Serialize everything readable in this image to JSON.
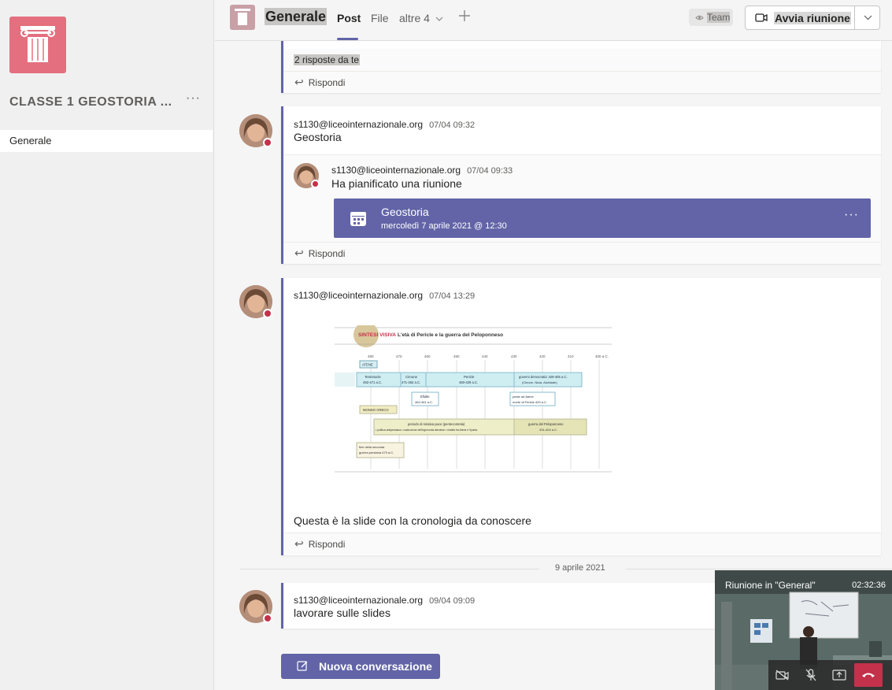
{
  "sidebar": {
    "team_name": "CLASSE 1 GEOSTORIA ...",
    "more_label": "···",
    "channels": [
      {
        "label": "Generale"
      }
    ]
  },
  "header": {
    "channel_title": "Generale",
    "tabs": {
      "post": "Post",
      "file": "File",
      "more": "altre 4"
    },
    "team_label": "Team",
    "meet_label": "Avvia riunione"
  },
  "thread0": {
    "replies_label": "2 risposte da te",
    "reply_label": "Rispondi"
  },
  "thread1": {
    "author": "s1130@liceointernazionale.org",
    "time": "07/04 09:32",
    "text": "Geostoria",
    "reply": {
      "author": "s1130@liceointernazionale.org",
      "time": "07/04 09:33",
      "text": "Ha pianificato una riunione",
      "meeting": {
        "title": "Geostoria",
        "when": "mercoledì 7 aprile 2021 @ 12:30",
        "more": "···"
      }
    },
    "reply_label": "Rispondi"
  },
  "thread2": {
    "author": "s1130@liceointernazionale.org",
    "time": "07/04 13:29",
    "text": "Questa è la slide con la cronologia da conoscere",
    "reply_label": "Rispondi",
    "slide": {
      "heading_tag": "SINTESI VISIVA",
      "heading": "L'età di Pericle e la guerra del Peloponneso",
      "years": [
        "480",
        "470",
        "460",
        "450",
        "440",
        "430",
        "420",
        "410",
        "400 a.C."
      ],
      "atene_label": "ATENE",
      "mondo_label": "MONDO GRECO",
      "temistocle": "Temistocle",
      "temistocle_years": "492-471 a.C.",
      "cimone": "Cimone",
      "cimone_years": "471-462 a.C.",
      "pericle": "Pericle",
      "pericle_years": "460-429 a.C.",
      "governi": "governi democratici 429-405 a.C.",
      "governi_sub": "(Cleone, Nicia, Alcibiade)",
      "efialte": "Efialte",
      "efialte_years": "462-461 a.C.",
      "peste": "peste ad Atene",
      "morte": "morte di Pericle 429 a.C.",
      "pace": "periodo di relativa pace (pentecontetia)",
      "pace_sub": "• politica antipersiana • costruzione dell'egemonia ateniese • rivalità fra Atene e Sparta",
      "guerra": "guerra del Peloponneso",
      "guerra_years": "431-404 a.C.",
      "fine": "fine della seconda",
      "fine2": "guerra persiana 479 a.C."
    }
  },
  "date_separator": "9 aprile 2021",
  "thread3": {
    "author": "s1130@liceointernazionale.org",
    "time": "09/04 09:09",
    "text": "lavorare sulle slides"
  },
  "new_conversation_label": "Nuova conversazione",
  "video": {
    "title": "Riunione in \"General\"",
    "elapsed": "02:32:36"
  },
  "colors": {
    "accent": "#6264a7",
    "end_call": "#c4314b",
    "team_avatar": "#e46f7f"
  }
}
